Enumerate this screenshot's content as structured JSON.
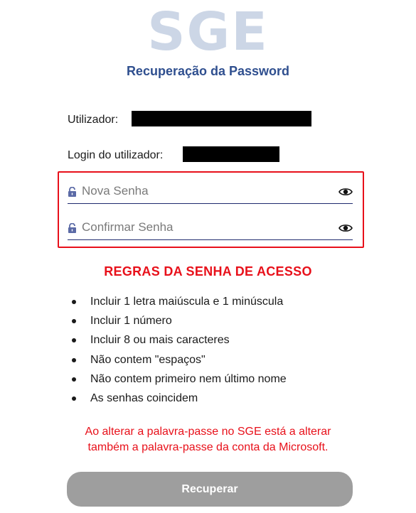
{
  "header": {
    "logo_text": "SGE",
    "subtitle": "Recuperação da Password"
  },
  "user_info": {
    "utilizador_label": "Utilizador:",
    "login_label": "Login do utilizador:"
  },
  "password_fields": {
    "new_password_placeholder": "Nova Senha",
    "confirm_password_placeholder": "Confirmar Senha",
    "lock_icon": "lock-icon",
    "eye_icon": "eye-icon"
  },
  "rules": {
    "title": "REGRAS DA SENHA DE ACESSO",
    "items": [
      "Incluir 1 letra maiúscula e 1 minúscula",
      "Incluir 1 número",
      "Incluir 8 ou mais caracteres",
      "Não contem \"espaços\"",
      "Não contem primeiro nem último nome",
      "As senhas coincidem"
    ]
  },
  "warning": {
    "line1": "Ao alterar a palavra-passe no SGE está a alterar",
    "line2": "também a palavra-passe da conta da Microsoft."
  },
  "submit": {
    "label": "Recuperar"
  },
  "colors": {
    "logo": "#ccd6e6",
    "subtitle": "#2f4f8f",
    "alert_red": "#e8101a",
    "button_disabled": "#9e9e9e",
    "field_underline": "#1e2a6e"
  }
}
